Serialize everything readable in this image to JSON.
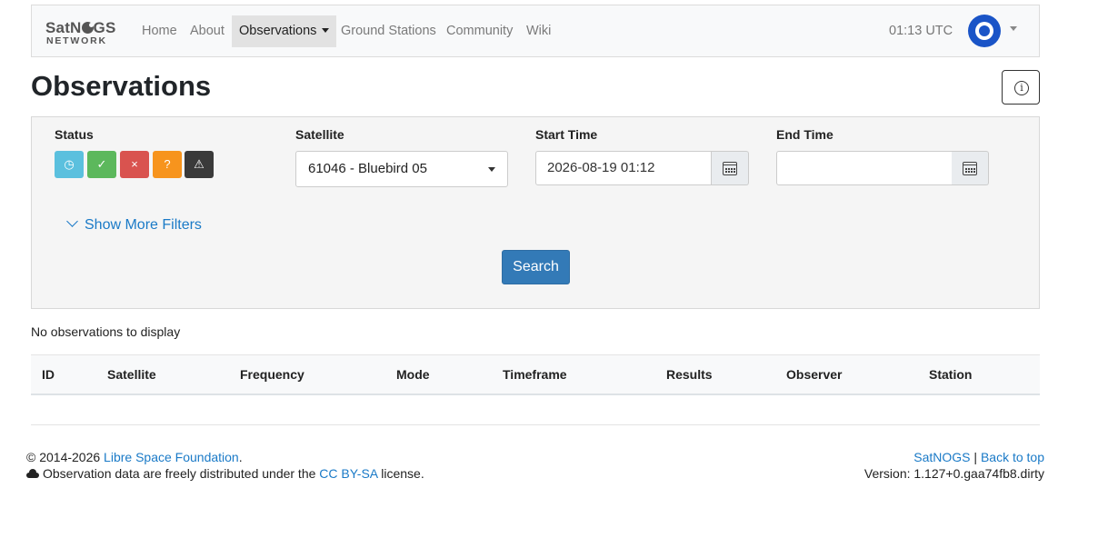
{
  "nav": {
    "brand_top": "SatN",
    "brand_top_rest": "GS",
    "brand_bottom": "NETWORK",
    "items": [
      {
        "label": "Home"
      },
      {
        "label": "About"
      },
      {
        "label": "Observations"
      },
      {
        "label": "Ground Stations"
      },
      {
        "label": "Community"
      },
      {
        "label": "Wiki"
      }
    ],
    "clock": "01:13 UTC"
  },
  "page": {
    "title": "Observations",
    "info_glyph": "i"
  },
  "filters": {
    "status_label": "Status",
    "status_buttons": [
      {
        "icon": "clock-icon",
        "glyph": "◷",
        "color": "#5bc0de"
      },
      {
        "icon": "check-icon",
        "glyph": "✓",
        "color": "#5cb85c"
      },
      {
        "icon": "x-icon",
        "glyph": "×",
        "color": "#d9534f"
      },
      {
        "icon": "question-icon",
        "glyph": "?",
        "color": "#f7941d"
      },
      {
        "icon": "warning-icon",
        "glyph": "⚠",
        "color": "#3a3a3a"
      }
    ],
    "satellite_label": "Satellite",
    "satellite_value": "61046 - Bluebird 05",
    "start_label": "Start Time",
    "start_value": "2026-08-19 01:12",
    "end_label": "End Time",
    "end_value": "",
    "more_filters": "Show More Filters",
    "search": "Search"
  },
  "results": {
    "empty_message": "No observations to display",
    "columns": [
      "ID",
      "Satellite",
      "Frequency",
      "Mode",
      "Timeframe",
      "Results",
      "Observer",
      "Station"
    ]
  },
  "footer": {
    "copyright": "© 2014-2026",
    "org": "Libre Space Foundation",
    "org_suffix": ".",
    "data_prefix": "Observation data are freely distributed under the",
    "license": "CC BY-SA",
    "data_suffix": "license.",
    "satnogs": "SatNOGS",
    "separator": "|",
    "back_to_top": "Back to top",
    "version": "Version: 1.127+0.gaa74fb8.dirty"
  },
  "colors": {
    "link": "#1a7ac7",
    "primary": "#337ab7",
    "avatar": "#1a54c7"
  }
}
